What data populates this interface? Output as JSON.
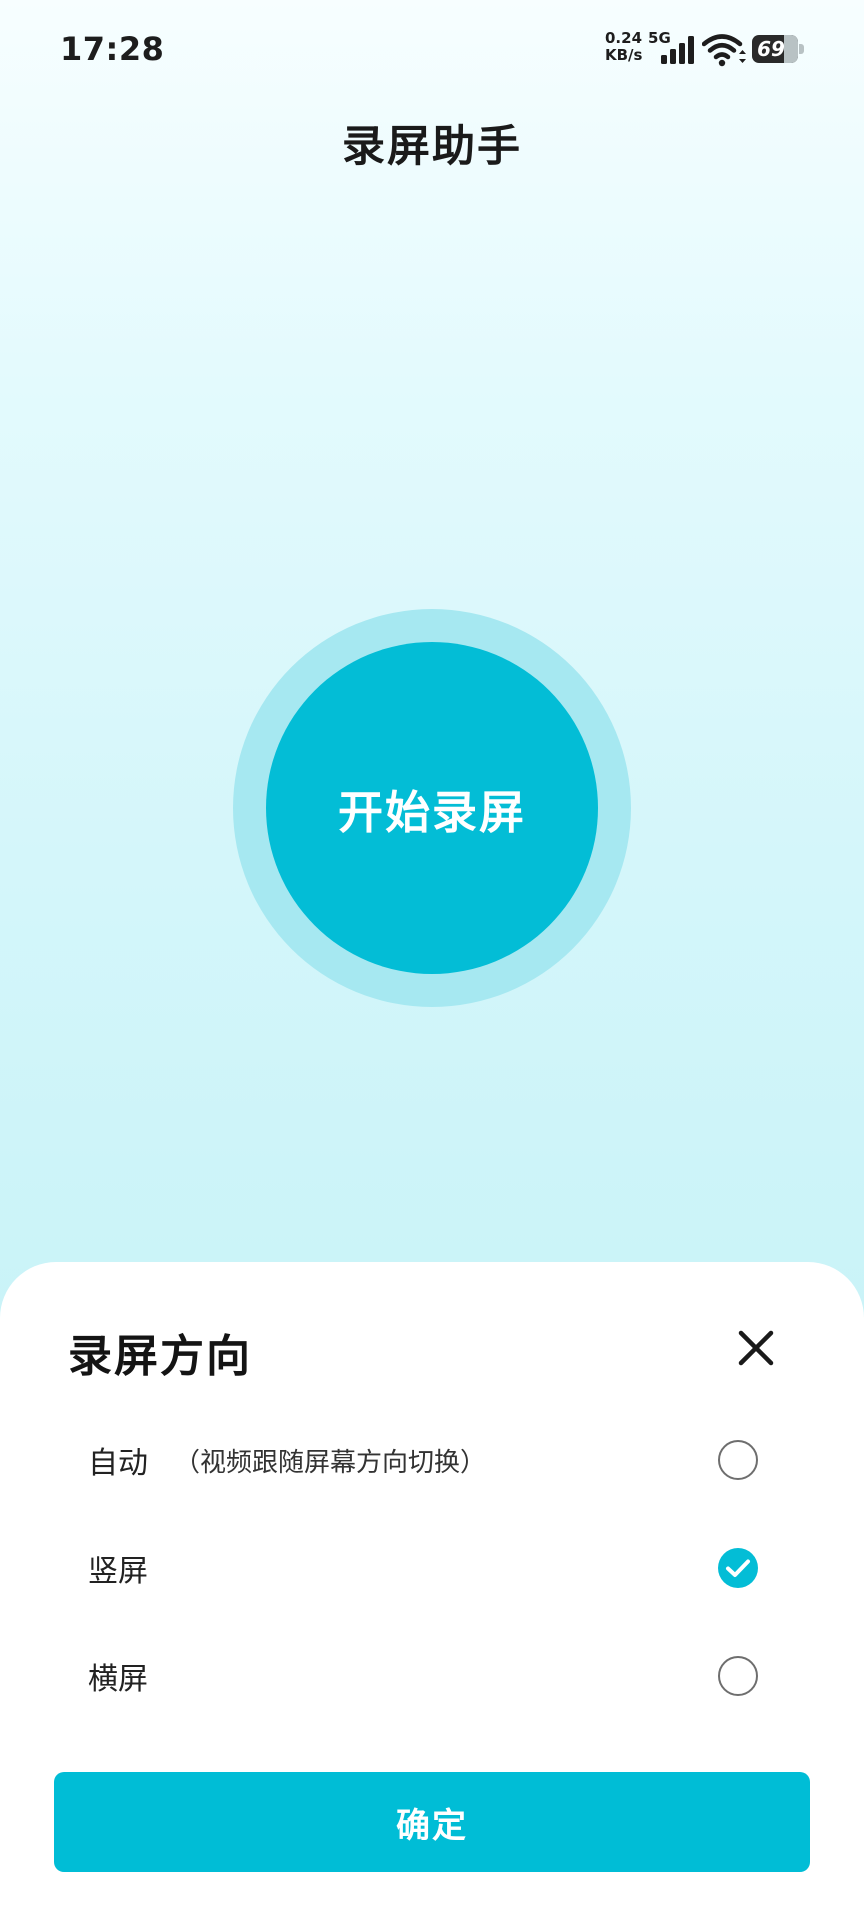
{
  "status_bar": {
    "time": "17:28",
    "net_speed_value": "0.24",
    "net_type": "5G",
    "net_speed_unit": "KB/s",
    "battery_level": "69",
    "battery_fraction": 0.69
  },
  "header": {
    "title": "录屏助手"
  },
  "record": {
    "label": "开始录屏",
    "color": "#03bdd6",
    "halo_color": "#a6e8f1"
  },
  "sheet": {
    "title": "录屏方向",
    "options": [
      {
        "label": "自动",
        "hint": "（视频跟随屏幕方向切换）",
        "selected": false
      },
      {
        "label": "竖屏",
        "hint": "",
        "selected": true
      },
      {
        "label": "横屏",
        "hint": "",
        "selected": false
      }
    ],
    "confirm_label": "确定"
  },
  "colors": {
    "accent": "#00bdd6",
    "text": "#1a1a1a"
  },
  "icons": {
    "close": "close-icon",
    "check": "check-icon",
    "signal": "signal-icon",
    "wifi": "wifi-icon"
  }
}
